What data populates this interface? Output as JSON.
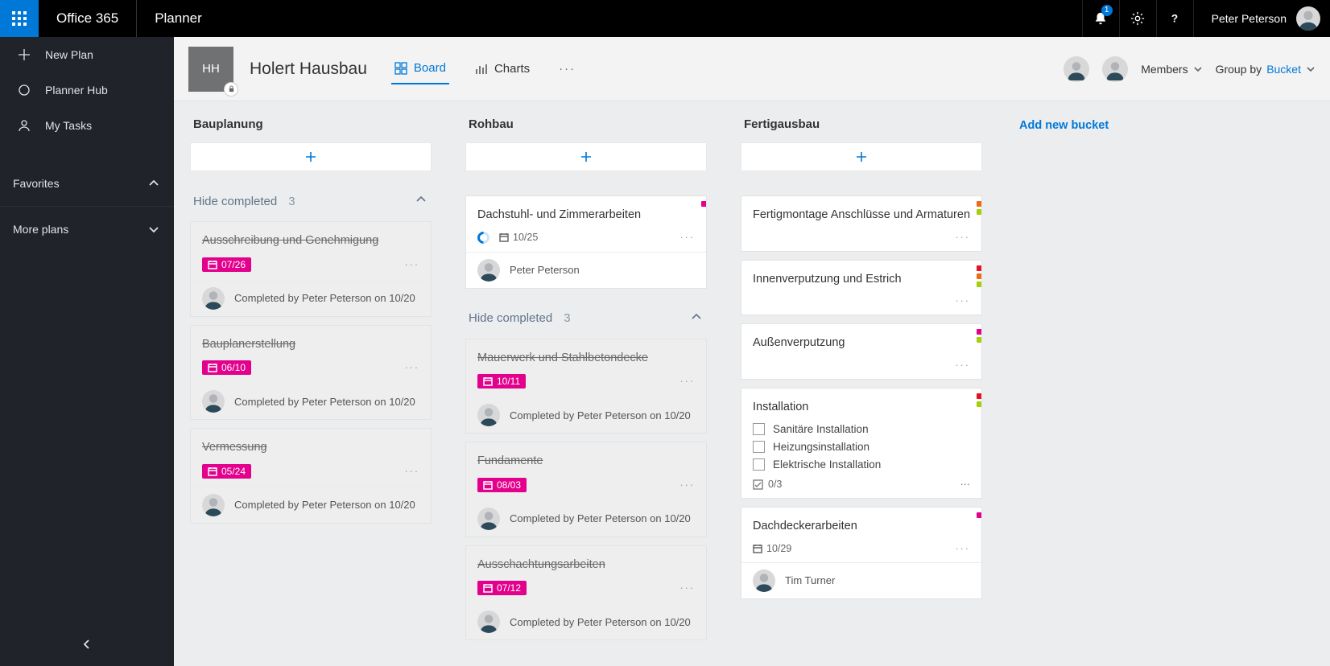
{
  "topbar": {
    "brand": "Office 365",
    "app": "Planner",
    "notification_count": "1",
    "user_name": "Peter Peterson"
  },
  "sidebar": {
    "new_plan": "New Plan",
    "planner_hub": "Planner Hub",
    "my_tasks": "My Tasks",
    "favorites": "Favorites",
    "more_plans": "More plans"
  },
  "plan": {
    "initials": "HH",
    "name": "Holert Hausbau",
    "tabs": {
      "board": "Board",
      "charts": "Charts"
    },
    "members_label": "Members",
    "group_by_prefix": "Group by",
    "group_by_value": "Bucket"
  },
  "buckets": {
    "bauplanung": {
      "title": "Bauplanung",
      "hide_label": "Hide completed",
      "hide_count": "3",
      "cards": [
        {
          "title": "Ausschreibung und Genehmigung",
          "date": "07/26",
          "completed_by": "Completed by Peter Peterson on 10/20"
        },
        {
          "title": "Bauplanerstellung",
          "date": "06/10",
          "completed_by": "Completed by Peter Peterson on 10/20"
        },
        {
          "title": "Vermessung",
          "date": "05/24",
          "completed_by": "Completed by Peter Peterson on 10/20"
        }
      ]
    },
    "rohbau": {
      "title": "Rohbau",
      "top_card": {
        "title": "Dachstuhl- und Zimmerarbeiten",
        "date": "10/25",
        "assignee": "Peter Peterson"
      },
      "hide_label": "Hide completed",
      "hide_count": "3",
      "cards": [
        {
          "title": "Mauerwerk und Stahlbetondecke",
          "date": "10/11",
          "completed_by": "Completed by Peter Peterson on 10/20"
        },
        {
          "title": "Fundamente",
          "date": "08/03",
          "completed_by": "Completed by Peter Peterson on 10/20"
        },
        {
          "title": "Ausschachtungsarbeiten",
          "date": "07/12",
          "completed_by": "Completed by Peter Peterson on 10/20"
        }
      ]
    },
    "fertigausbau": {
      "title": "Fertigausbau",
      "cards": {
        "c0": {
          "title": "Fertigmontage Anschlüsse und Armaturen"
        },
        "c1": {
          "title": "Innenverputzung und Estrich"
        },
        "c2": {
          "title": "Außenverputzung"
        },
        "c3": {
          "title": "Installation",
          "checklist": [
            "Sanitäre Installation",
            "Heizungsinstallation",
            "Elektrische Installation"
          ],
          "check_summary": "0/3"
        },
        "c4": {
          "title": "Dachdeckerarbeiten",
          "date": "10/29",
          "assignee": "Tim Turner"
        }
      }
    },
    "add_bucket": "Add new bucket"
  },
  "colors": {
    "magenta": "#e3008c",
    "orange": "#f06a16",
    "green": "#8cbd18",
    "lime": "#a4cf0c",
    "red": "#e81123"
  }
}
